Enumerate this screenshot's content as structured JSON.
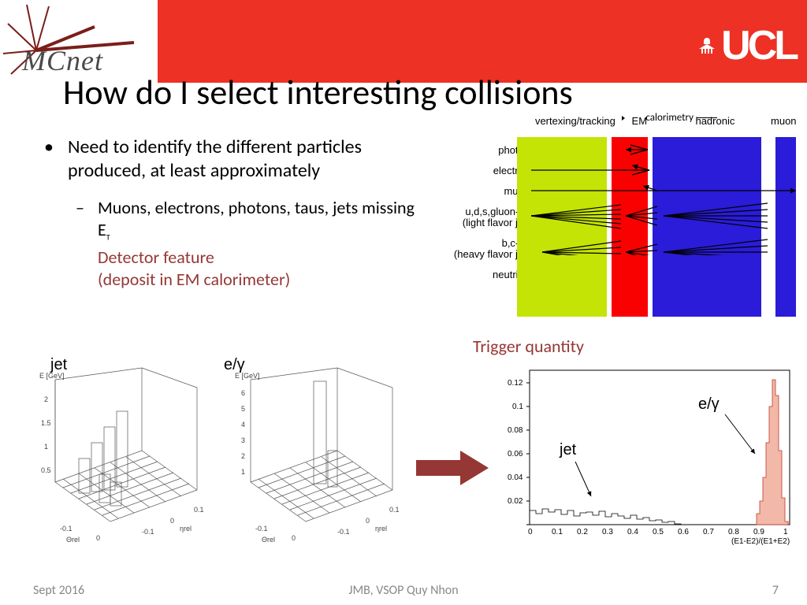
{
  "header": {
    "mcnet": "MCnet",
    "ucl": "UCL"
  },
  "title": "How do I select interesting collisions",
  "bullets": {
    "b1": "Need to identify the different particles produced, at least approximately",
    "b2_pre": "Muons, electrons, photons, taus, jets missing E",
    "b2_sub": "T",
    "detector_feature_l1": "Detector feature",
    "detector_feature_l2": "(deposit in EM calorimeter)"
  },
  "detector_diagram": {
    "top_labels": {
      "vt": "vertexing/tracking",
      "em": "EM",
      "calor": "calorimetry",
      "had": "hadronic",
      "muon": "muon"
    },
    "rows": {
      "photon": "photon",
      "electron": "electron",
      "muon": "muon",
      "light_l1": "u,d,s,gluon-jet",
      "light_l2": "(light flavor jet)",
      "heavy_l1": "b,c-jet",
      "heavy_l2": "(heavy flavor jet)",
      "neutrino": "neutrino"
    }
  },
  "trigger_label": "Trigger quantity",
  "lego": {
    "label_jet": "jet",
    "label_eg": "e/γ",
    "ylabel": "E [GeV]",
    "y_ticks_jet": [
      "0.5",
      "1",
      "1.5",
      "2"
    ],
    "y_ticks_eg": [
      "1",
      "2",
      "3",
      "4",
      "5",
      "6"
    ],
    "x1label": "Θrel",
    "x2label": "ηrel",
    "plane_ticks": [
      "-0.1",
      "0",
      "0.1"
    ]
  },
  "chart_data": {
    "type": "bar",
    "title": "",
    "xlabel": "(E1-E2)/(E1+E2)",
    "ylabel": "",
    "xlim": [
      0,
      1
    ],
    "ylim": [
      0,
      0.13
    ],
    "x_ticks": [
      "0",
      "0.1",
      "0.2",
      "0.3",
      "0.4",
      "0.5",
      "0.6",
      "0.7",
      "0.8",
      "0.9",
      "1"
    ],
    "y_ticks": [
      "0.02",
      "0.04",
      "0.06",
      "0.08",
      "0.1",
      "0.12"
    ],
    "annotations": {
      "jet": "jet",
      "eg": "e/γ"
    },
    "series": [
      {
        "name": "jet",
        "x_range": [
          0.0,
          0.6
        ],
        "approx_values": [
          0.012,
          0.01,
          0.014,
          0.011,
          0.013,
          0.009,
          0.012,
          0.008,
          0.01,
          0.011,
          0.009,
          0.012,
          0.007,
          0.01,
          0.008,
          0.006,
          0.009,
          0.005,
          0.007,
          0.004,
          0.006,
          0.003,
          0.005,
          0.002
        ]
      },
      {
        "name": "e/γ",
        "x_range": [
          0.88,
          1.0
        ],
        "approx_values": [
          0.01,
          0.02,
          0.04,
          0.07,
          0.1,
          0.125,
          0.11,
          0.06,
          0.02
        ]
      }
    ]
  },
  "footer": {
    "left": "Sept 2016",
    "center": "JMB, VSOP Quy Nhon",
    "right": "7"
  }
}
